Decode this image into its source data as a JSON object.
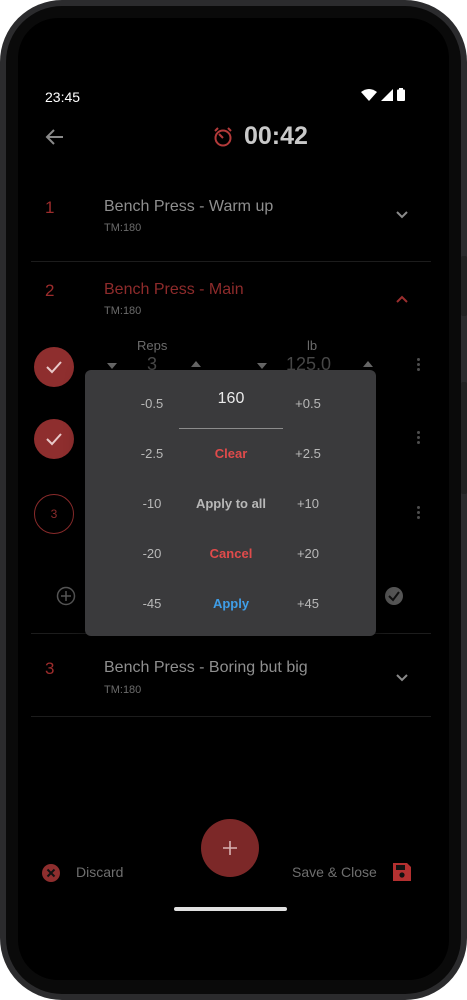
{
  "status": {
    "time": "23:45"
  },
  "header": {
    "timer": "00:42"
  },
  "exercises": [
    {
      "number": "1",
      "title": "Bench Press - Warm up",
      "tm": "TM:180"
    },
    {
      "number": "2",
      "title": "Bench Press - Main",
      "tm": "TM:180"
    },
    {
      "number": "3",
      "title": "Bench Press - Boring but big",
      "tm": "TM:180"
    }
  ],
  "set_editor": {
    "reps_label": "Reps",
    "reps_value": "3",
    "weight_label": "lb",
    "weight_value": "125.0"
  },
  "set_ring_label": "3",
  "dialog": {
    "value": "160",
    "left_keys": [
      "-0.5",
      "-2.5",
      "-10",
      "-20",
      "-45"
    ],
    "right_keys": [
      "+0.5",
      "+2.5",
      "+10",
      "+20",
      "+45"
    ],
    "clear": "Clear",
    "apply_all": "Apply to all",
    "cancel": "Cancel",
    "apply": "Apply"
  },
  "bottom": {
    "discard": "Discard",
    "save_close": "Save & Close"
  },
  "colors": {
    "accent_red": "#8e2e2e",
    "danger_text": "#e04b4b",
    "apply_blue": "#3f9ee8",
    "dialog_bg": "#3a3a3c"
  }
}
